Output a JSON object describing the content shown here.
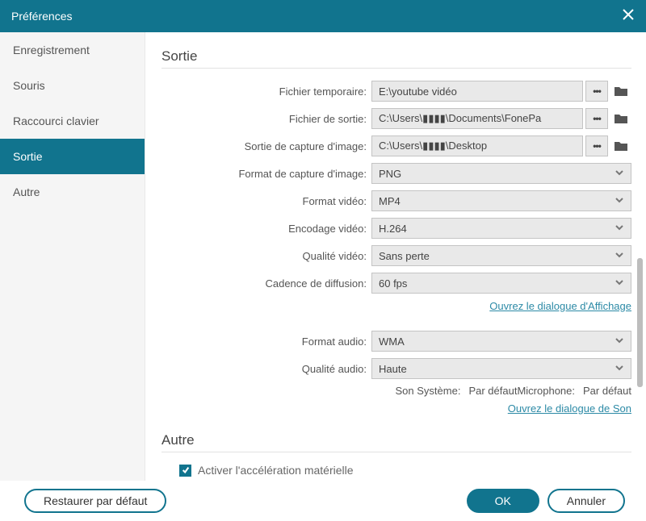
{
  "window": {
    "title": "Préférences"
  },
  "sidebar": {
    "items": [
      {
        "label": "Enregistrement"
      },
      {
        "label": "Souris"
      },
      {
        "label": "Raccourci clavier"
      },
      {
        "label": "Sortie"
      },
      {
        "label": "Autre"
      }
    ],
    "active_index": 3
  },
  "sections": {
    "sortie": {
      "title": "Sortie",
      "rows": {
        "temp": {
          "label": "Fichier temporaire:",
          "value": "E:\\youtube vidéo"
        },
        "output": {
          "label": "Fichier de sortie:",
          "value": "C:\\Users\\▮▮▮▮\\Documents\\FonePa"
        },
        "img_output": {
          "label": "Sortie de capture d'image:",
          "value": "C:\\Users\\▮▮▮▮\\Desktop"
        },
        "img_format": {
          "label": "Format de capture d'image:",
          "value": "PNG"
        },
        "vid_format": {
          "label": "Format vidéo:",
          "value": "MP4"
        },
        "vid_enc": {
          "label": "Encodage vidéo:",
          "value": "H.264"
        },
        "vid_quality": {
          "label": "Qualité vidéo:",
          "value": "Sans perte"
        },
        "fps": {
          "label": "Cadence de diffusion:",
          "value": "60 fps"
        },
        "aud_format": {
          "label": "Format audio:",
          "value": "WMA"
        },
        "aud_quality": {
          "label": "Qualité audio:",
          "value": "Haute"
        }
      },
      "static": {
        "syssound_label": "Son Système:",
        "syssound_value": "Par défaut",
        "mic_label": "Microphone:",
        "mic_value": "Par défaut"
      },
      "links": {
        "display": "Ouvrez le dialogue d'Affichage",
        "sound": "Ouvrez le dialogue de Son"
      }
    },
    "autre": {
      "title": "Autre",
      "hw_accel": {
        "label": "Activer l'accélération matérielle",
        "checked": true
      }
    }
  },
  "footer": {
    "restore": "Restaurer par défaut",
    "ok": "OK",
    "cancel": "Annuler"
  }
}
